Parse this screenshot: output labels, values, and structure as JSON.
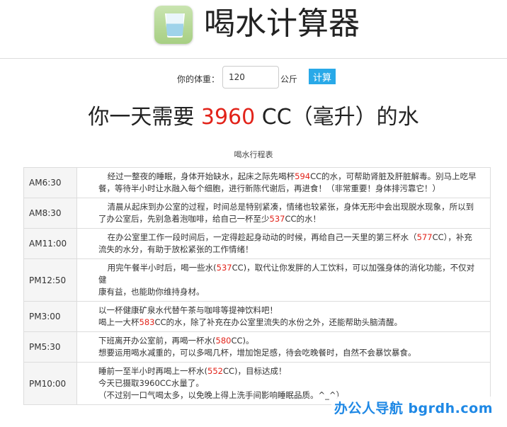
{
  "header": {
    "title": "喝水计算器",
    "icon": "water-glass-icon"
  },
  "form": {
    "weight_label": "你的体重：",
    "weight_value": "120",
    "unit": "公斤",
    "submit_label": "计算"
  },
  "result": {
    "prefix": "你一天需要 ",
    "amount": "3960",
    "suffix": " CC（毫升）的水"
  },
  "schedule": {
    "title": "喝水行程表",
    "rows": [
      {
        "time": "AM6:30",
        "lines": [
          [
            {
              "t": "经过一整夜的睡眠，身体开始缺水，起床之际先喝杯"
            },
            {
              "t": "594",
              "hl": true
            },
            {
              "t": "CC的水，可帮助肾脏及肝脏解毒。别马上吃早"
            }
          ],
          [
            {
              "t": "餐，等待半小时让水融入每个细胞，进行新陈代谢后，再进食！（非常重要！身体排污靠它！）"
            }
          ]
        ]
      },
      {
        "time": "AM8:30",
        "lines": [
          [
            {
              "t": "清晨从起床到办公室的过程，时间总是特别紧凑，情绪也较紧张，身体无形中会出现脱水现象，所以到"
            }
          ],
          [
            {
              "t": "了办公室后，先别急着泡咖啡，给自己一杯至少"
            },
            {
              "t": "537",
              "hl": true
            },
            {
              "t": "CC的水！"
            }
          ]
        ]
      },
      {
        "time": "AM11:00",
        "lines": [
          [
            {
              "t": "在办公室里工作一段时间后，一定得趁起身动动的时候，再给自己一天里的第三杯水（"
            },
            {
              "t": "577",
              "hl": true
            },
            {
              "t": "CC），补充"
            }
          ],
          [
            {
              "t": "流失的水分，有助于放松紧张的工作情绪！"
            }
          ]
        ]
      },
      {
        "time": "PM12:50",
        "lines": [
          [
            {
              "t": "用完午餐半小时后，喝一些水("
            },
            {
              "t": "537",
              "hl": true
            },
            {
              "t": "CC)，取代让你发胖的人工饮料，可以加强身体的消化功能，不仅对健"
            }
          ],
          [
            {
              "t": "康有益，也能助你维持身材。"
            }
          ]
        ]
      },
      {
        "time": "PM3:00",
        "lines": [
          [
            {
              "t": "以一杯健康矿泉水代替午茶与咖啡等提神饮料吧！"
            }
          ],
          [
            {
              "t": "喝上一大杯"
            },
            {
              "t": "583",
              "hl": true
            },
            {
              "t": "CC的水，除了补充在办公室里流失的水份之外，还能帮助头脑清醒。"
            }
          ]
        ]
      },
      {
        "time": "PM5:30",
        "lines": [
          [
            {
              "t": "下班离开办公室前，再喝一杯水("
            },
            {
              "t": "580",
              "hl": true
            },
            {
              "t": "CC)。"
            }
          ],
          [
            {
              "t": "想要运用喝水减重的，可以多喝几杯，增加饱足感，待会吃晚餐时，自然不会暴饮暴食。"
            }
          ]
        ]
      },
      {
        "time": "PM10:00",
        "lines": [
          [
            {
              "t": "睡前一至半小时再喝上一杯水("
            },
            {
              "t": "552",
              "hl": true
            },
            {
              "t": "CC)，目标达成！"
            }
          ],
          [
            {
              "t": "今天已摄取3960CC水量了。"
            }
          ],
          [
            {
              "t": "（不过别一口气喝太多，以免晚上得上洗手间影响睡眠品质。^_^）"
            }
          ]
        ]
      }
    ]
  },
  "watermark": "办公人导航 bgrdh.com",
  "colors": {
    "accent": "#29a9e8",
    "highlight": "#e2231a"
  }
}
